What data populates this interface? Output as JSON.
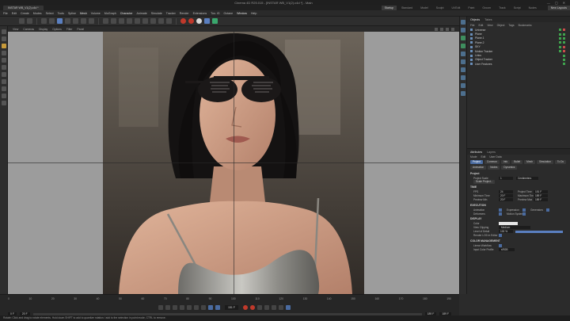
{
  "window": {
    "title": "Cinema 4D R25.015 - [INSTAR WB_V1(2).c4d *] - Main",
    "minimize": "—",
    "maximize": "▢",
    "close": "✕"
  },
  "doc_tabs": [
    "INSTAR WB_V1(2).c4d *"
  ],
  "layout_tabs": [
    {
      "label": "Startup",
      "active": true
    },
    {
      "label": "Standard",
      "active": false
    },
    {
      "label": "Model",
      "active": false
    },
    {
      "label": "Sculpt",
      "active": false
    },
    {
      "label": "UVEdit",
      "active": false
    },
    {
      "label": "Paint",
      "active": false
    },
    {
      "label": "Groom",
      "active": false
    },
    {
      "label": "Track",
      "active": false
    },
    {
      "label": "Script",
      "active": false
    },
    {
      "label": "Nodes",
      "active": false
    }
  ],
  "new_layout_label": "New Layouts",
  "menu": [
    "File",
    "Edit",
    "Create",
    "Modes",
    "Select",
    "Tools",
    "Spline",
    "Mesh",
    "Volume",
    "MoGraph",
    "Character",
    "Animate",
    "Simulate",
    "Tracker",
    "Render",
    "Extensions",
    "Too. iG",
    "Octane",
    "Window",
    "Help"
  ],
  "viewport_menu": [
    "View",
    "Cameras",
    "Display",
    "Options",
    "Filter",
    "Panel"
  ],
  "object_manager": {
    "tabs": [
      "Objects",
      "Takes"
    ],
    "menu": [
      "File",
      "Edit",
      "View",
      "Object",
      "Tags",
      "Bookmarks"
    ],
    "objects": [
      "Universe",
      "Plane",
      "Plane.1",
      "Plane.2",
      "SKY",
      "Motion Tracker",
      "Links",
      "Object Tracker",
      "User Features"
    ]
  },
  "attributes": {
    "tabs": [
      "Attributes",
      "Layers"
    ],
    "mode_menu": [
      "Mode",
      "Edit",
      "User Data"
    ],
    "buttons": [
      "Project",
      "Common",
      "Info",
      "Bullet",
      "Mesh",
      "Simulation",
      "To Do",
      "Animation",
      "Nodes",
      "Dynamics"
    ],
    "section_project": "Project",
    "project_scale_label": "Project Scale",
    "project_scale_value": "1",
    "project_scale_unit": "Centimeters",
    "scale_project_button": "Scale Project...",
    "section_time": "TIME",
    "fps_label": "FPS",
    "fps_value": "24",
    "project_time_label": "Project Time",
    "project_time_value": "151 F",
    "min_time_label": "Minimum Time",
    "min_time_value": "20 F",
    "max_time_label": "Maximum Time",
    "max_time_value": "189 F",
    "preview_min_label": "Preview Min",
    "preview_min_value": "20 F",
    "preview_max_label": "Preview Max",
    "preview_max_value": "189 F",
    "section_execution": "EXECUTION",
    "animation_label": "Animation",
    "expression_label": "Expression",
    "generators_label": "Generators",
    "deformers_label": "Deformers",
    "motion_system_label": "Motion System",
    "section_display": "DISPLAY",
    "color_label": "Color",
    "view_clipping_label": "View Clipping",
    "view_clipping_value": "Medium",
    "lod_label": "Level of Detail",
    "lod_value": "100 %",
    "lod_fraction": 1.0,
    "render_lod_label": "Render LOD in Editor",
    "section_color": "COLOR MANAGEMENT",
    "linear_workflow_label": "Linear Workflow",
    "input_color_label": "Input Color Profile",
    "input_color_value": "sRGB"
  },
  "timeline": {
    "ticks": [
      "0",
      "10",
      "20",
      "30",
      "40",
      "50",
      "60",
      "70",
      "80",
      "90",
      "100",
      "110",
      "120",
      "130",
      "140",
      "150",
      "160",
      "170",
      "180",
      "190"
    ],
    "current_frame": "151 F",
    "start": "0 F",
    "min": "20 F",
    "max": "189 F",
    "end": "189 F"
  },
  "status_text": "Rotate: Click and drag to rotate elements. Hold down SHIFT to add to quantize rotation / add to the selection in point mode, CTRL to remove."
}
